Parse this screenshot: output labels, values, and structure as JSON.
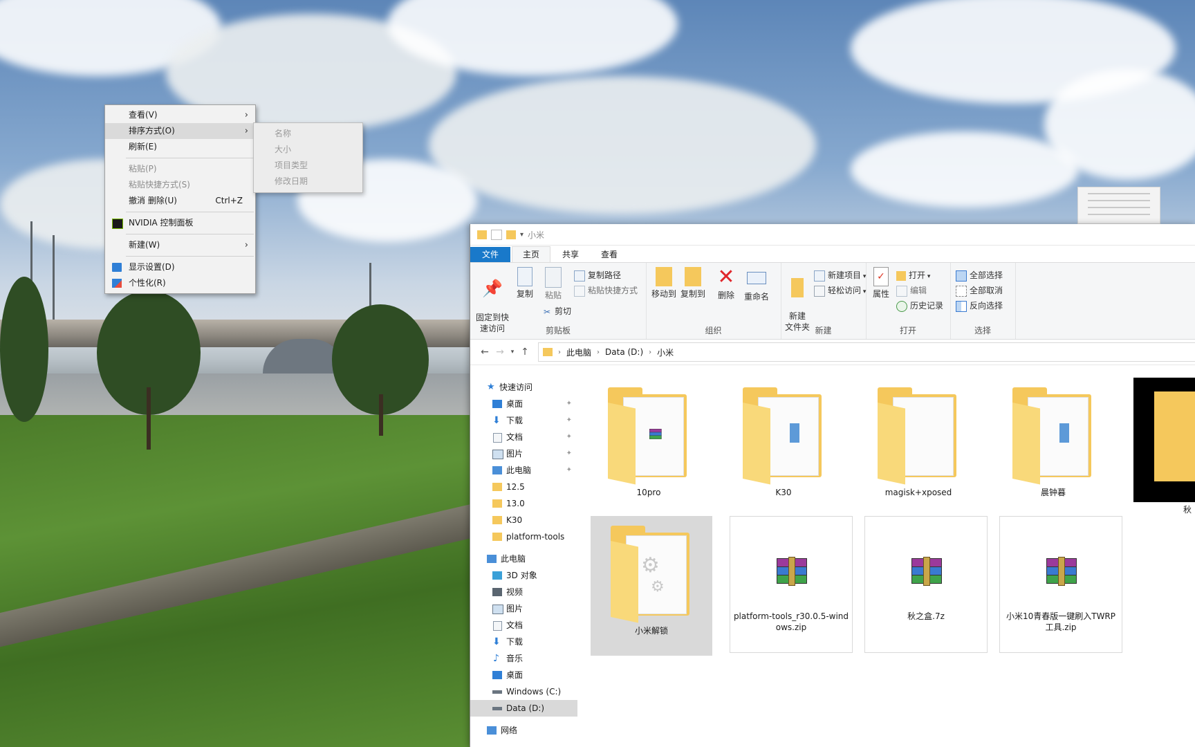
{
  "context_menu": {
    "items": [
      {
        "label": "查看(V)",
        "enabled": true,
        "submenu": true
      },
      {
        "label": "排序方式(O)",
        "enabled": true,
        "submenu": true,
        "highlighted": true
      },
      {
        "label": "刷新(E)",
        "enabled": true
      },
      {
        "label": "粘贴(P)",
        "enabled": false
      },
      {
        "label": "粘贴快捷方式(S)",
        "enabled": false
      },
      {
        "label": "撤消 删除(U)",
        "shortcut": "Ctrl+Z",
        "enabled": true
      },
      {
        "label": "NVIDIA 控制面板",
        "enabled": true,
        "icon": "nvidia-icon"
      },
      {
        "label": "新建(W)",
        "enabled": true,
        "submenu": true
      },
      {
        "label": "显示设置(D)",
        "enabled": true,
        "icon": "display-icon"
      },
      {
        "label": "个性化(R)",
        "enabled": true,
        "icon": "personalize-icon"
      }
    ]
  },
  "sort_submenu": {
    "items": [
      "名称",
      "大小",
      "项目类型",
      "修改日期"
    ]
  },
  "explorer": {
    "title": "小米",
    "tabs": [
      "文件",
      "主页",
      "共享",
      "查看"
    ],
    "ribbon": {
      "clipboard": {
        "label": "剪贴板",
        "pin": "固定到快\n速访问",
        "copy": "复制",
        "paste": "粘贴",
        "copy_path": "复制路径",
        "paste_shortcut": "粘贴快捷方式",
        "cut": "剪切"
      },
      "organize": {
        "label": "组织",
        "move_to": "移动到",
        "copy_to": "复制到",
        "delete": "删除",
        "rename": "重命名"
      },
      "new": {
        "label": "新建",
        "new_folder": "新建\n文件夹",
        "new_item": "新建项目",
        "easy_access": "轻松访问"
      },
      "open": {
        "label": "打开",
        "properties": "属性",
        "open": "打开",
        "edit": "编辑",
        "history": "历史记录"
      },
      "select": {
        "label": "选择",
        "select_all": "全部选择",
        "select_none": "全部取消",
        "invert": "反向选择"
      }
    },
    "breadcrumb": [
      "此电脑",
      "Data (D:)",
      "小米"
    ],
    "nav": {
      "quick_access": "快速访问",
      "quick_items": [
        "桌面",
        "下载",
        "文档",
        "图片",
        "此电脑",
        "12.5",
        "13.0",
        "K30",
        "platform-tools"
      ],
      "this_pc": "此电脑",
      "pc_items": [
        "3D 对象",
        "视频",
        "图片",
        "文档",
        "下载",
        "音乐",
        "桌面",
        "Windows (C:)",
        "Data (D:)"
      ],
      "network": "网络"
    },
    "files": [
      {
        "name": "10pro",
        "type": "folder"
      },
      {
        "name": "K30",
        "type": "folder"
      },
      {
        "name": "magisk+xposed",
        "type": "folder"
      },
      {
        "name": "晨钟暮",
        "type": "folder"
      },
      {
        "name": "小米解锁",
        "type": "folder",
        "selected": true
      },
      {
        "name": "platform-tools_r30.0.5-windows.zip",
        "type": "archive"
      },
      {
        "name": "秋之盒.7z",
        "type": "archive"
      },
      {
        "name": "小米10青春版一键刷入TWRP工具.zip",
        "type": "archive"
      }
    ],
    "edge_label": "秋"
  },
  "colors": {
    "accent": "#1979ca",
    "folder": "#f5c85c",
    "selection": "#cce8ff"
  }
}
